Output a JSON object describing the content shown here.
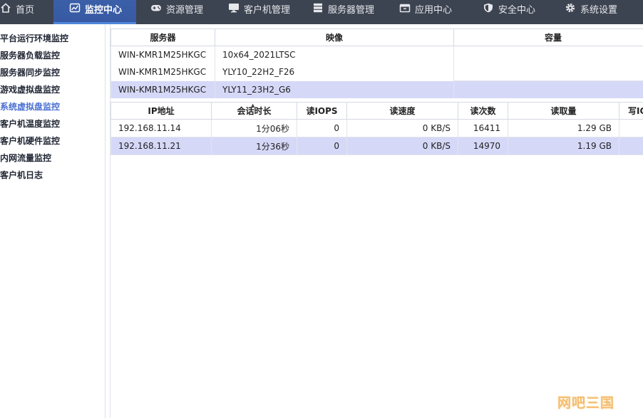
{
  "nav": {
    "items": [
      {
        "label": "首页",
        "icon": "home-icon"
      },
      {
        "label": "监控中心",
        "icon": "monitor-chart-icon",
        "active": true
      },
      {
        "label": "资源管理",
        "icon": "gamepad-icon"
      },
      {
        "label": "客户机管理",
        "icon": "display-icon"
      },
      {
        "label": "服务器管理",
        "icon": "server-icon"
      },
      {
        "label": "应用中心",
        "icon": "app-box-icon"
      },
      {
        "label": "安全中心",
        "icon": "shield-icon"
      },
      {
        "label": "系统设置",
        "icon": "gear-icon"
      }
    ]
  },
  "sidebar": {
    "items": [
      {
        "label": "平台运行环境监控"
      },
      {
        "label": "服务器负载监控"
      },
      {
        "label": "服务器同步监控"
      },
      {
        "label": "游戏虚拟盘监控"
      },
      {
        "label": "系统虚拟盘监控",
        "active": true
      },
      {
        "label": "客户机温度监控"
      },
      {
        "label": "客户机硬件监控"
      },
      {
        "label": "内网流量监控"
      },
      {
        "label": "客户机日志"
      }
    ]
  },
  "server_table": {
    "headers": [
      "服务器",
      "映像",
      "容量"
    ],
    "rows": [
      {
        "server": "WIN-KMR1M25HKGC",
        "image": "10x64_2021LTSC",
        "capacity": ""
      },
      {
        "server": "WIN-KMR1M25HKGC",
        "image": "YLY10_22H2_F26",
        "capacity": ""
      },
      {
        "server": "WIN-KMR1M25HKGC",
        "image": "YLY11_23H2_G6",
        "capacity": "",
        "selected": true
      }
    ]
  },
  "session_table": {
    "headers": [
      "IP地址",
      "会话时长",
      "读IOPS",
      "读速度",
      "读次数",
      "读取量",
      "写IO"
    ],
    "rows": [
      {
        "ip": "192.168.11.14",
        "duration": "1分06秒",
        "read_iops": "0",
        "read_speed": "0 KB/S",
        "read_count": "16411",
        "read_amount": "1.29 GB",
        "write_io": ""
      },
      {
        "ip": "192.168.11.21",
        "duration": "1分36秒",
        "read_iops": "0",
        "read_speed": "0 KB/S",
        "read_count": "14970",
        "read_amount": "1.19 GB",
        "write_io": "",
        "selected": true
      }
    ]
  },
  "watermark": "网吧三国",
  "colors": {
    "nav_bg": "#3d4451",
    "nav_active": "#3b5fa8",
    "sidebar_active": "#4a6fd1",
    "row_selected": "#d6d8f8",
    "watermark": "#f3b257"
  }
}
